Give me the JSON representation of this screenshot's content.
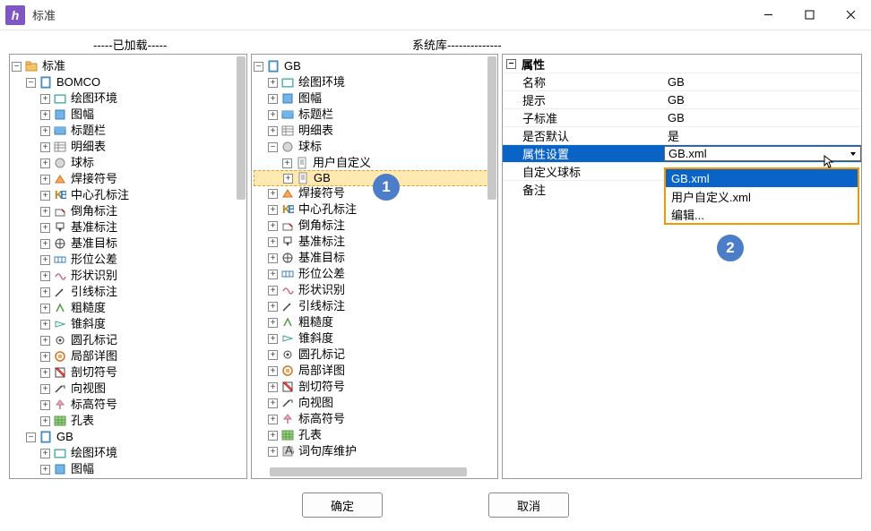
{
  "window": {
    "title": "标准"
  },
  "headers": {
    "left": "-----已加载-----",
    "mid": "系统库---------------------------------------------------------------------"
  },
  "leftTree": {
    "root": "标准",
    "sub": "BOMCO",
    "items": [
      "绘图环境",
      "图幅",
      "标题栏",
      "明细表",
      "球标",
      "焊接符号",
      "中心孔标注",
      "倒角标注",
      "基准标注",
      "基准目标",
      "形位公差",
      "形状识别",
      "引线标注",
      "粗糙度",
      "锥斜度",
      "圆孔标记",
      "局部详图",
      "剖切符号",
      "向视图",
      "标高符号",
      "孔表"
    ],
    "gb": "GB",
    "gbItems": [
      "绘图环境",
      "图幅"
    ]
  },
  "midTree": {
    "root": "GB",
    "preBallItems": [
      "绘图环境",
      "图幅",
      "标题栏",
      "明细表"
    ],
    "ball": "球标",
    "ballChildren": [
      "用户自定义",
      "GB"
    ],
    "postBallItems": [
      "焊接符号",
      "中心孔标注",
      "倒角标注",
      "基准标注",
      "基准目标",
      "形位公差",
      "形状识别",
      "引线标注",
      "粗糙度",
      "锥斜度",
      "圆孔标记",
      "局部详图",
      "剖切符号",
      "向视图",
      "标高符号",
      "孔表",
      "词句库维护"
    ]
  },
  "props": {
    "header": "属性",
    "rows": [
      {
        "k": "名称",
        "v": "GB"
      },
      {
        "k": "提示",
        "v": "GB"
      },
      {
        "k": "子标准",
        "v": "GB"
      },
      {
        "k": "是否默认",
        "v": "是"
      },
      {
        "k": "属性设置",
        "v": "GB.xml"
      },
      {
        "k": "自定义球标",
        "v": ""
      },
      {
        "k": "备注",
        "v": ""
      }
    ]
  },
  "dropdown": {
    "options": [
      "GB.xml",
      "用户自定义.xml",
      "编辑..."
    ],
    "selected": 0
  },
  "badges": {
    "one": "1",
    "two": "2"
  },
  "footer": {
    "ok": "确定",
    "cancel": "取消"
  },
  "iconKinds": {
    "leftItems": [
      "env",
      "frame",
      "titleblk",
      "detail",
      "ball",
      "weld",
      "center",
      "chamfer",
      "datum",
      "target",
      "gtol",
      "shape",
      "leader",
      "rough",
      "taper",
      "hole",
      "detailview",
      "section",
      "view",
      "elev",
      "table"
    ],
    "leftGb": [
      "env",
      "frame"
    ],
    "midPre": [
      "env",
      "frame",
      "titleblk",
      "detail"
    ],
    "midPost": [
      "weld",
      "center",
      "chamfer",
      "datum",
      "target",
      "gtol",
      "shape",
      "leader",
      "rough",
      "taper",
      "hole",
      "detailview",
      "section",
      "view",
      "elev",
      "table",
      "dict"
    ]
  }
}
